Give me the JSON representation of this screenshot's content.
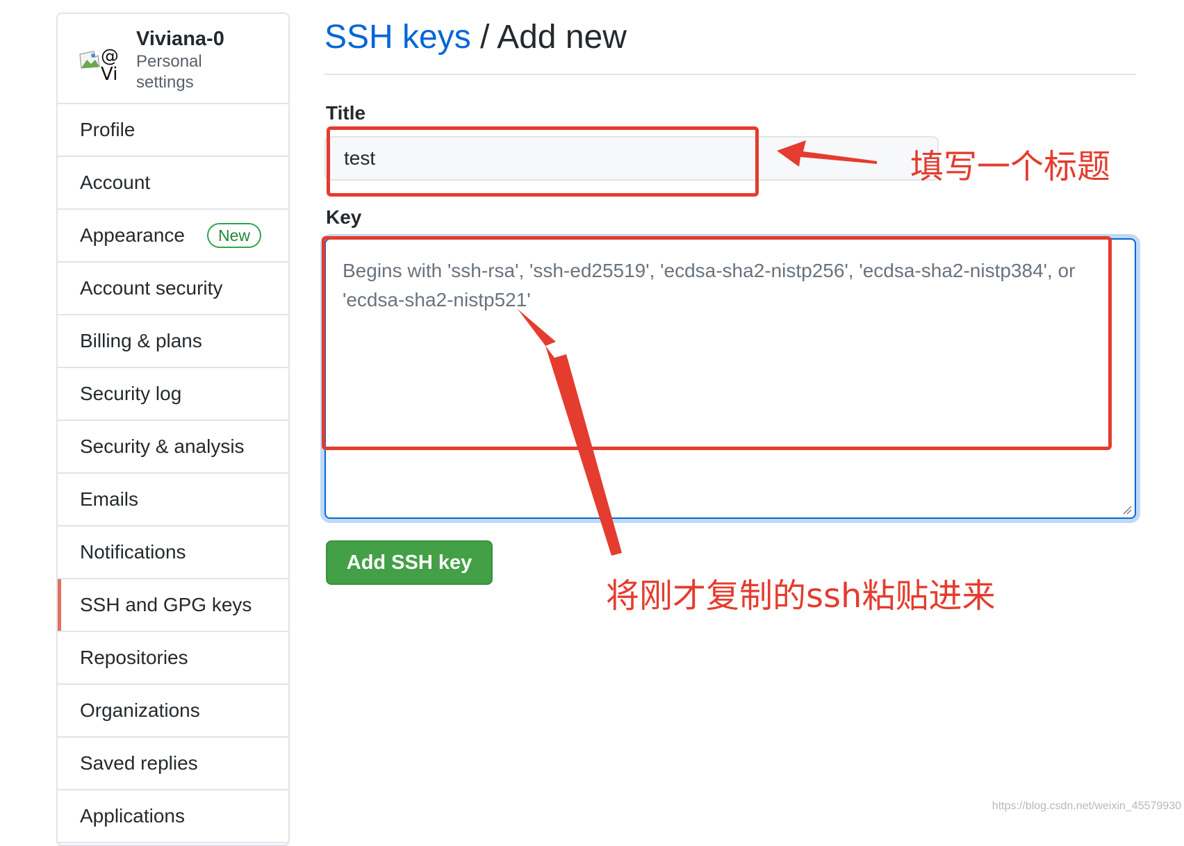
{
  "user": {
    "avatar_alt": "@\nVi",
    "name": "Viviana-0",
    "subtitle": "Personal settings"
  },
  "sidebar": {
    "items": [
      {
        "label": "Profile"
      },
      {
        "label": "Account"
      },
      {
        "label": "Appearance",
        "badge": "New"
      },
      {
        "label": "Account security"
      },
      {
        "label": "Billing & plans"
      },
      {
        "label": "Security log"
      },
      {
        "label": "Security & analysis"
      },
      {
        "label": "Emails"
      },
      {
        "label": "Notifications"
      },
      {
        "label": "SSH and GPG keys",
        "selected": true
      },
      {
        "label": "Repositories"
      },
      {
        "label": "Organizations"
      },
      {
        "label": "Saved replies"
      },
      {
        "label": "Applications"
      }
    ]
  },
  "header": {
    "breadcrumb_link": "SSH keys",
    "separator": " / ",
    "current": "Add new"
  },
  "form": {
    "title_label": "Title",
    "title_value": "test",
    "key_label": "Key",
    "key_placeholder": "Begins with 'ssh-rsa', 'ssh-ed25519', 'ecdsa-sha2-nistp256', 'ecdsa-sha2-nistp384', or 'ecdsa-sha2-nistp521'",
    "submit_label": "Add SSH key"
  },
  "annotations": {
    "title_note": "填写一个标题",
    "key_note": "将刚才复制的ssh粘贴进来",
    "color": "#e43c2e"
  },
  "watermark": "https://blog.csdn.net/weixin_45579930",
  "colors": {
    "link": "#0366d6",
    "button_green": "#43a047",
    "badge_green": "#22863a",
    "selected_marker": "#e36f5c"
  }
}
